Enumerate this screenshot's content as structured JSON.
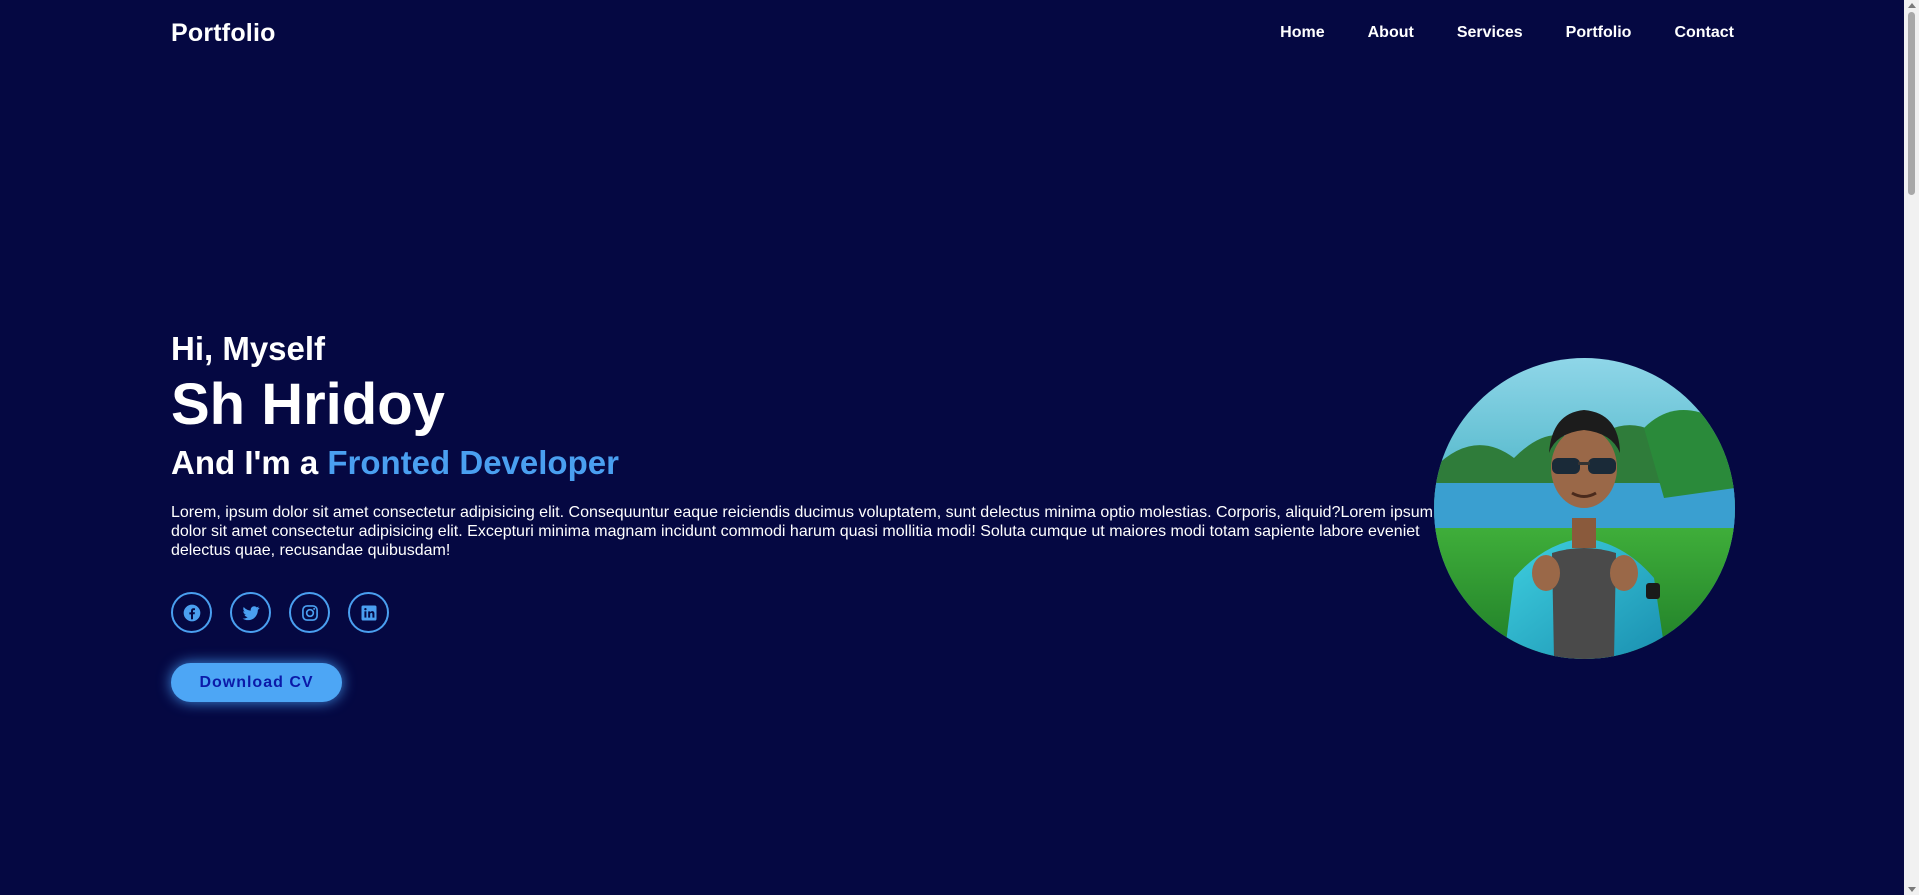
{
  "navbar": {
    "logo": "Portfolio",
    "links": [
      "Home",
      "About",
      "Services",
      "Portfolio",
      "Contact"
    ]
  },
  "hero": {
    "greeting": "Hi, Myself",
    "name": "Sh Hridoy",
    "role_prefix": "And I'm a ",
    "role_highlight": "Fronted Developer",
    "bio": "Lorem, ipsum dolor sit amet consectetur adipisicing elit. Consequuntur eaque reiciendis ducimus voluptatem, sunt delectus minima optio molestias. Corporis, aliquid?Lorem ipsum dolor sit amet consectetur adipisicing elit. Excepturi minima magnam incidunt commodi harum quasi mollitia modi! Soluta cumque ut maiores modi totam sapiente labore eveniet delectus quae, recusandae quibusdam!",
    "socials": [
      "facebook-icon",
      "twitter-icon",
      "instagram-icon",
      "linkedin-icon"
    ],
    "download_label": "Download CV"
  },
  "colors": {
    "background": "#050842",
    "accent": "#4a9ff0",
    "button_bg": "#4da6f5",
    "button_text": "#0b1aa8"
  }
}
